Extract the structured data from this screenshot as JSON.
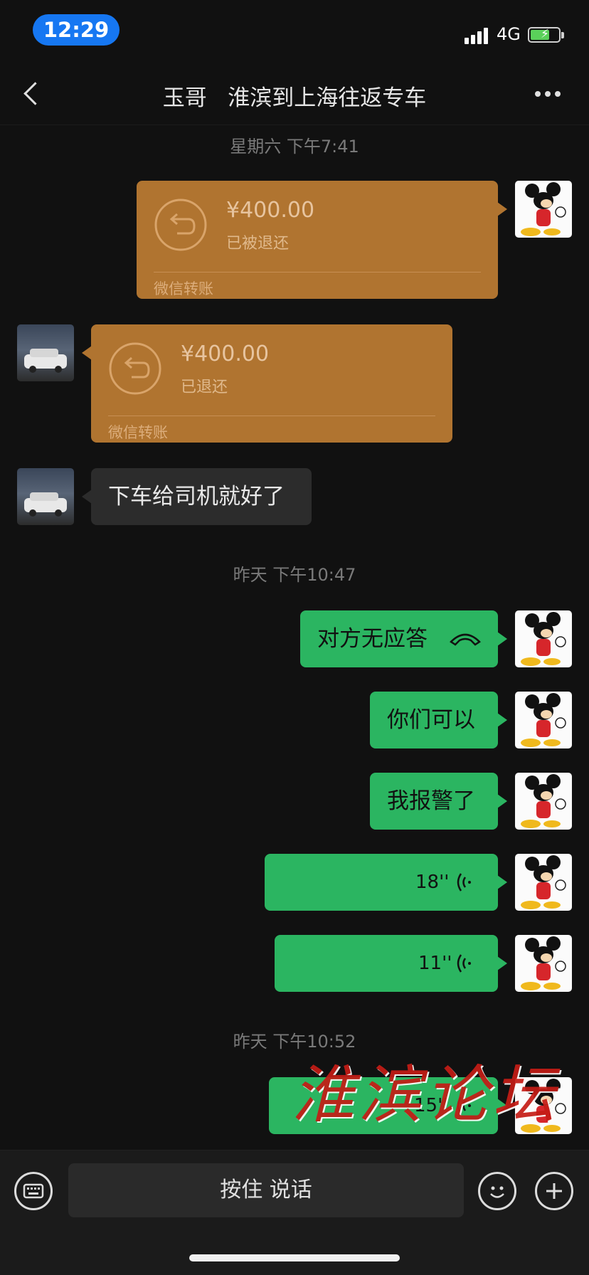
{
  "status": {
    "time": "12:29",
    "network": "4G"
  },
  "nav": {
    "title": "玉哥   淮滨到上海往返专车"
  },
  "timestamps": [
    "星期六 下午7:41",
    "昨天 下午10:47",
    "昨天 下午10:52"
  ],
  "messages": [
    {
      "type": "transfer",
      "side": "self",
      "amount": "¥400.00",
      "status": "已被退还",
      "footer": "微信转账"
    },
    {
      "type": "transfer",
      "side": "other",
      "amount": "¥400.00",
      "status": "已退还",
      "footer": "微信转账"
    },
    {
      "type": "text",
      "side": "other",
      "text": "下车给司机就好了"
    },
    {
      "type": "call",
      "side": "self",
      "text": "对方无应答"
    },
    {
      "type": "text",
      "side": "self",
      "text": "你们可以"
    },
    {
      "type": "text",
      "side": "self",
      "text": "我报警了"
    },
    {
      "type": "voice",
      "side": "self",
      "duration": "18''"
    },
    {
      "type": "voice",
      "side": "self",
      "duration": "11''"
    },
    {
      "type": "voice",
      "side": "self",
      "duration": "15''"
    }
  ],
  "watermark": "淮滨论坛",
  "input_bar": {
    "hold_to_talk": "按住 说话"
  },
  "icons": [
    "back-icon",
    "more-icon",
    "transfer-return-icon",
    "hang-up-icon",
    "voice-wave-icon",
    "keyboard-icon",
    "emoji-icon",
    "plus-icon"
  ],
  "colors": {
    "background": "#111111",
    "self_bubble": "#2bb561",
    "other_bubble": "#2c2c2c",
    "transfer_card": "#b07430",
    "time_pill": "#1677f2"
  }
}
